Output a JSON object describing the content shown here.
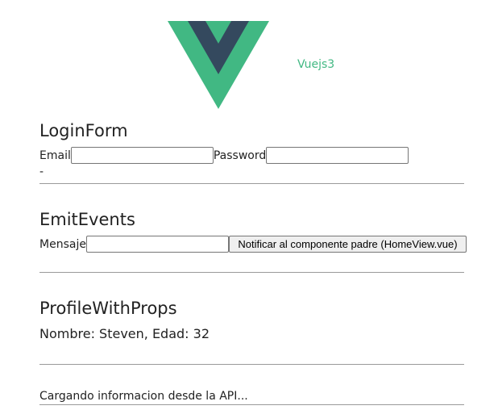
{
  "nav": {
    "link_label": "Vuejs3"
  },
  "brand": {
    "logo_icon": "vue-logo-icon",
    "outer_color": "#41b883",
    "inner_color": "#34495e"
  },
  "login_form": {
    "title": "LoginForm",
    "email_label": "Email",
    "email_value": "",
    "password_label": "Password",
    "password_value": "",
    "status_text": "-"
  },
  "emit_events": {
    "title": "EmitEvents",
    "message_label": "Mensaje",
    "message_value": "",
    "notify_button_label": "Notificar al componente padre (HomeView.vue)"
  },
  "profile": {
    "title": "ProfileWithProps",
    "info_text": "Nombre: Steven, Edad: 32"
  },
  "api": {
    "loading_text": "Cargando informacion desde la API..."
  }
}
